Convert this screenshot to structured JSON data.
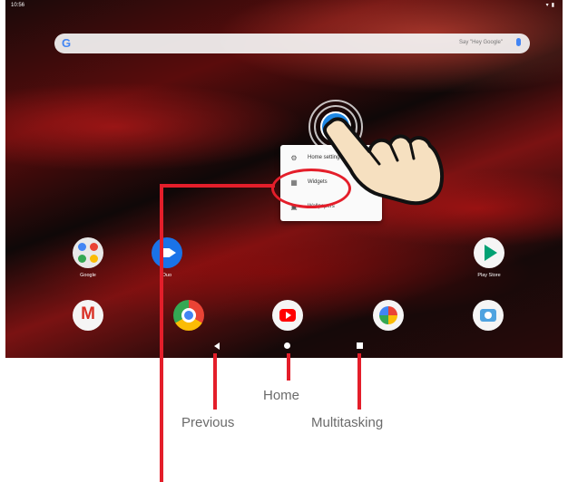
{
  "status_bar": {
    "time": "10:56",
    "icons": [
      "wifi-icon",
      "battery-icon"
    ]
  },
  "search_bar": {
    "logo": "G",
    "hint": "Say \"Hey Google\""
  },
  "context_menu": {
    "items": [
      {
        "label": "Home settings",
        "icon": "gear-icon"
      },
      {
        "label": "Widgets",
        "icon": "widgets-icon"
      },
      {
        "label": "Wallpapers",
        "icon": "wallpaper-icon"
      }
    ]
  },
  "home_apps": [
    {
      "label": "Google",
      "icon": "google-folder-icon"
    },
    {
      "label": "Duo",
      "icon": "duo-icon"
    },
    {
      "label": "Play Store",
      "icon": "play-store-icon"
    }
  ],
  "dock_apps": [
    "gmail-icon",
    "chrome-icon",
    "youtube-icon",
    "photos-icon",
    "camera-icon"
  ],
  "nav_buttons": [
    "back-button",
    "home-button",
    "recents-button"
  ],
  "annotations": {
    "previous": "Previous",
    "home": "Home",
    "multitasking": "Multitasking"
  },
  "colors": {
    "annotation_red": "#e41e2a",
    "menu_bg": "#fafafa",
    "touch_blue": "#1e88e5"
  }
}
